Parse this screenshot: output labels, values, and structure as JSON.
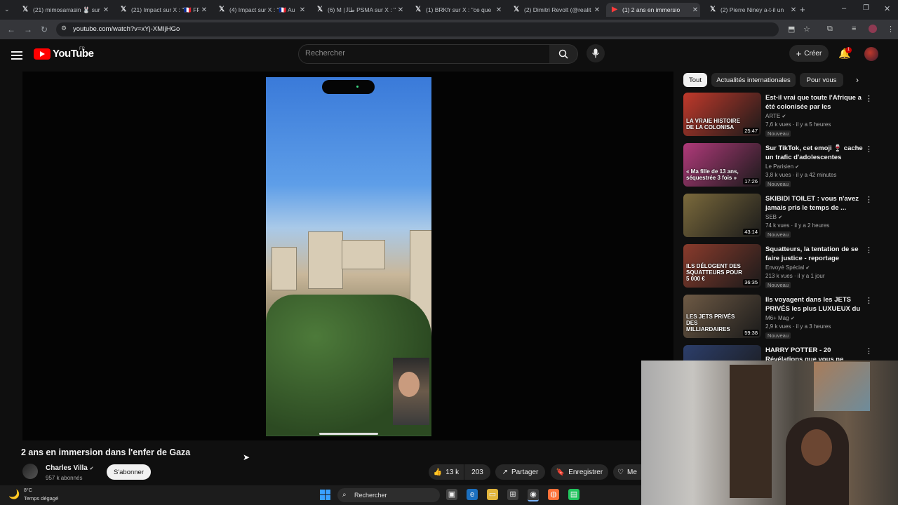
{
  "browser": {
    "tabs": [
      {
        "label": "(21) mimosarrasin 🐰 sur",
        "icon": "x-logo-icon"
      },
      {
        "label": "(21) Impact sur X : \"🇫🇷 FR",
        "icon": "x-logo-icon"
      },
      {
        "label": "(4) Impact sur X : \"🇫🇷 Au",
        "icon": "x-logo-icon"
      },
      {
        "label": "(6) M | ﻃﺎﻟ PSMA sur X : \"Il",
        "icon": "x-logo-icon"
      },
      {
        "label": "(1) BRKfr sur X : \"ce que",
        "icon": "x-logo-icon"
      },
      {
        "label": "(2) Dimitri Revolt (@realit",
        "icon": "x-logo-icon"
      },
      {
        "label": "(1) 2 ans en immersio",
        "icon": "youtube-icon",
        "active": true
      },
      {
        "label": "(2) Pierre Niney a-t-il un",
        "icon": "x-logo-icon"
      }
    ],
    "url": "youtube.com/watch?v=xYj-XMIjHGo"
  },
  "header": {
    "logo_text": "YouTube",
    "region": "FR",
    "search_placeholder": "Rechercher",
    "create_label": "Créer",
    "notification_count": "1"
  },
  "video": {
    "title": "2 ans en immersion dans l'enfer de Gaza",
    "channel": "Charles Villa",
    "subscribers": "957 k abonnés",
    "subscribe_label": "S'abonner",
    "likes": "13 k",
    "comments": "203",
    "share_label": "Partager",
    "save_label": "Enregistrer",
    "more_label": "Me"
  },
  "chips": [
    "Tout",
    "Actualités internationales",
    "Pour vous"
  ],
  "recommendations": [
    {
      "title": "Est-il vrai que toute l'Afrique a été colonisée par les Européen...",
      "channel": "ARTE",
      "meta": "7,6 k vues · il y a 5 heures",
      "badge": "Nouveau",
      "duration": "25:47",
      "thumb_text": "LA VRAIE HISTOIRE DE LA COLONISA",
      "thumb_color": "#c0392b"
    },
    {
      "title": "Sur TikTok, cet emoji 🍷 cache un trafic d'adolescentes",
      "channel": "Le Parisien",
      "meta": "3,8 k vues · il y a 42 minutes",
      "badge": "Nouveau",
      "duration": "17:26",
      "thumb_text": "« Ma fille de 13 ans, séquestrée 3 fois »",
      "thumb_color": "#b03a7a"
    },
    {
      "title": "SKIBIDI TOILET : vous n'avez jamais pris le temps de ...",
      "channel": "SEB",
      "meta": "74 k vues · il y a 2 heures",
      "badge": "Nouveau",
      "duration": "43:14",
      "thumb_text": "",
      "thumb_color": "#7b6a3c"
    },
    {
      "title": "Squatteurs, la tentation de se faire justice - reportage intégral",
      "channel": "Envoyé Spécial",
      "meta": "213 k vues · il y a 1 jour",
      "badge": "Nouveau",
      "duration": "36:35",
      "thumb_text": "ILS DÉLOGENT DES SQUATTEURS POUR 5 000 €",
      "thumb_color": "#8a3b2c"
    },
    {
      "title": "Ils voyagent dans les JETS PRIVÉS les plus LUXUEUX du ...",
      "channel": "M6+ Mag",
      "meta": "2,9 k vues · il y a 3 heures",
      "badge": "Nouveau",
      "duration": "59:38",
      "thumb_text": "LES JETS PRIVÉS DES MILLIARDAIRES",
      "thumb_color": "#6e5a45"
    },
    {
      "title": "HARRY POTTER - 20 Révélations que vous ne",
      "channel": "",
      "meta": "",
      "badge": "",
      "duration": "",
      "thumb_text": "20 Révélations Que vous n'avez",
      "thumb_color": "#2c3e6b"
    }
  ],
  "taskbar": {
    "temp": "8°C",
    "weather": "Temps dégagé",
    "search_label": "Rechercher"
  }
}
